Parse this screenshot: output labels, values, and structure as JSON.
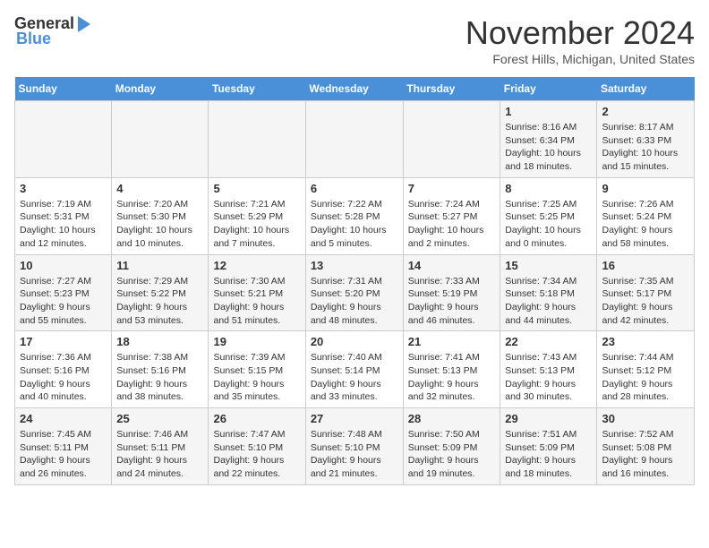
{
  "header": {
    "logo_general": "General",
    "logo_blue": "Blue",
    "month_title": "November 2024",
    "location": "Forest Hills, Michigan, United States"
  },
  "calendar": {
    "days_of_week": [
      "Sunday",
      "Monday",
      "Tuesday",
      "Wednesday",
      "Thursday",
      "Friday",
      "Saturday"
    ],
    "weeks": [
      [
        {
          "day": "",
          "info": ""
        },
        {
          "day": "",
          "info": ""
        },
        {
          "day": "",
          "info": ""
        },
        {
          "day": "",
          "info": ""
        },
        {
          "day": "",
          "info": ""
        },
        {
          "day": "1",
          "info": "Sunrise: 8:16 AM\nSunset: 6:34 PM\nDaylight: 10 hours and 18 minutes."
        },
        {
          "day": "2",
          "info": "Sunrise: 8:17 AM\nSunset: 6:33 PM\nDaylight: 10 hours and 15 minutes."
        }
      ],
      [
        {
          "day": "3",
          "info": "Sunrise: 7:19 AM\nSunset: 5:31 PM\nDaylight: 10 hours and 12 minutes."
        },
        {
          "day": "4",
          "info": "Sunrise: 7:20 AM\nSunset: 5:30 PM\nDaylight: 10 hours and 10 minutes."
        },
        {
          "day": "5",
          "info": "Sunrise: 7:21 AM\nSunset: 5:29 PM\nDaylight: 10 hours and 7 minutes."
        },
        {
          "day": "6",
          "info": "Sunrise: 7:22 AM\nSunset: 5:28 PM\nDaylight: 10 hours and 5 minutes."
        },
        {
          "day": "7",
          "info": "Sunrise: 7:24 AM\nSunset: 5:27 PM\nDaylight: 10 hours and 2 minutes."
        },
        {
          "day": "8",
          "info": "Sunrise: 7:25 AM\nSunset: 5:25 PM\nDaylight: 10 hours and 0 minutes."
        },
        {
          "day": "9",
          "info": "Sunrise: 7:26 AM\nSunset: 5:24 PM\nDaylight: 9 hours and 58 minutes."
        }
      ],
      [
        {
          "day": "10",
          "info": "Sunrise: 7:27 AM\nSunset: 5:23 PM\nDaylight: 9 hours and 55 minutes."
        },
        {
          "day": "11",
          "info": "Sunrise: 7:29 AM\nSunset: 5:22 PM\nDaylight: 9 hours and 53 minutes."
        },
        {
          "day": "12",
          "info": "Sunrise: 7:30 AM\nSunset: 5:21 PM\nDaylight: 9 hours and 51 minutes."
        },
        {
          "day": "13",
          "info": "Sunrise: 7:31 AM\nSunset: 5:20 PM\nDaylight: 9 hours and 48 minutes."
        },
        {
          "day": "14",
          "info": "Sunrise: 7:33 AM\nSunset: 5:19 PM\nDaylight: 9 hours and 46 minutes."
        },
        {
          "day": "15",
          "info": "Sunrise: 7:34 AM\nSunset: 5:18 PM\nDaylight: 9 hours and 44 minutes."
        },
        {
          "day": "16",
          "info": "Sunrise: 7:35 AM\nSunset: 5:17 PM\nDaylight: 9 hours and 42 minutes."
        }
      ],
      [
        {
          "day": "17",
          "info": "Sunrise: 7:36 AM\nSunset: 5:16 PM\nDaylight: 9 hours and 40 minutes."
        },
        {
          "day": "18",
          "info": "Sunrise: 7:38 AM\nSunset: 5:16 PM\nDaylight: 9 hours and 38 minutes."
        },
        {
          "day": "19",
          "info": "Sunrise: 7:39 AM\nSunset: 5:15 PM\nDaylight: 9 hours and 35 minutes."
        },
        {
          "day": "20",
          "info": "Sunrise: 7:40 AM\nSunset: 5:14 PM\nDaylight: 9 hours and 33 minutes."
        },
        {
          "day": "21",
          "info": "Sunrise: 7:41 AM\nSunset: 5:13 PM\nDaylight: 9 hours and 32 minutes."
        },
        {
          "day": "22",
          "info": "Sunrise: 7:43 AM\nSunset: 5:13 PM\nDaylight: 9 hours and 30 minutes."
        },
        {
          "day": "23",
          "info": "Sunrise: 7:44 AM\nSunset: 5:12 PM\nDaylight: 9 hours and 28 minutes."
        }
      ],
      [
        {
          "day": "24",
          "info": "Sunrise: 7:45 AM\nSunset: 5:11 PM\nDaylight: 9 hours and 26 minutes."
        },
        {
          "day": "25",
          "info": "Sunrise: 7:46 AM\nSunset: 5:11 PM\nDaylight: 9 hours and 24 minutes."
        },
        {
          "day": "26",
          "info": "Sunrise: 7:47 AM\nSunset: 5:10 PM\nDaylight: 9 hours and 22 minutes."
        },
        {
          "day": "27",
          "info": "Sunrise: 7:48 AM\nSunset: 5:10 PM\nDaylight: 9 hours and 21 minutes."
        },
        {
          "day": "28",
          "info": "Sunrise: 7:50 AM\nSunset: 5:09 PM\nDaylight: 9 hours and 19 minutes."
        },
        {
          "day": "29",
          "info": "Sunrise: 7:51 AM\nSunset: 5:09 PM\nDaylight: 9 hours and 18 minutes."
        },
        {
          "day": "30",
          "info": "Sunrise: 7:52 AM\nSunset: 5:08 PM\nDaylight: 9 hours and 16 minutes."
        }
      ]
    ]
  }
}
